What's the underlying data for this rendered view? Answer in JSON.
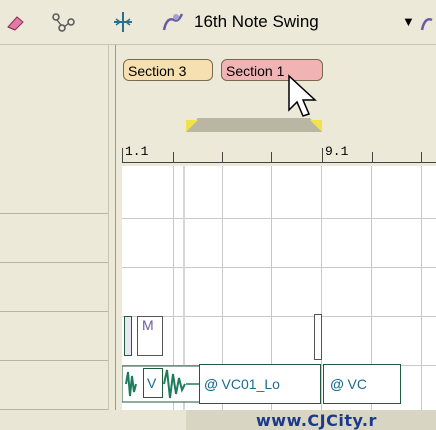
{
  "toolbar": {
    "groove_label": "16th Note Swing",
    "dropdown_arrow": "▼",
    "icons": [
      "eraser-icon",
      "connect-nodes-icon",
      "split-icon",
      "groove-icon",
      "groove-icon-2"
    ]
  },
  "sections": [
    {
      "label": "Section 3",
      "color": "#f6dfb0"
    },
    {
      "label": "Section 1",
      "color": "#f1b3b3"
    }
  ],
  "ruler": {
    "marks": [
      "1.1",
      "9.1"
    ]
  },
  "clips": {
    "upper_clip_label": "M",
    "lower_clip_1_label": "V",
    "lower_clip_2_label": "VC01_Lo",
    "lower_clip_3_label": "VC"
  },
  "watermark": "www.CJCity.r",
  "colors": {
    "accent": "#3a6df0",
    "clip_border": "#215a3c",
    "clip_text": "#1b6c8c"
  }
}
